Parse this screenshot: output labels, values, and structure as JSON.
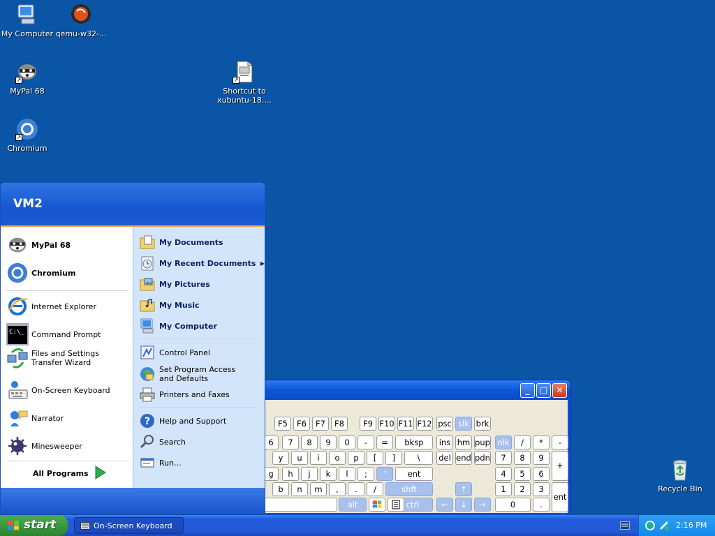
{
  "desktop": {
    "icons": [
      {
        "label": "My Computer"
      },
      {
        "label": "qemu-w32-..."
      },
      {
        "label": "MyPal 68"
      },
      {
        "label": "Shortcut to xubuntu-18...."
      },
      {
        "label": "Chromium"
      },
      {
        "label": "Recycle Bin"
      }
    ]
  },
  "start_menu": {
    "user": "VM2",
    "pinned": [
      {
        "label": "MyPal 68"
      },
      {
        "label": "Chromium"
      }
    ],
    "recent": [
      {
        "label": "Internet Explorer"
      },
      {
        "label": "Command Prompt"
      },
      {
        "label": "Files and Settings Transfer Wizard"
      },
      {
        "label": "On-Screen Keyboard"
      },
      {
        "label": "Narrator"
      },
      {
        "label": "Minesweeper"
      }
    ],
    "all_programs": "All Programs",
    "right": [
      {
        "label": "My Documents"
      },
      {
        "label": "My Recent Documents"
      },
      {
        "label": "My Pictures"
      },
      {
        "label": "My Music"
      },
      {
        "label": "My Computer"
      },
      {
        "label": "Control Panel"
      },
      {
        "label": "Set Program Access and Defaults"
      },
      {
        "label": "Printers and Faxes"
      },
      {
        "label": "Help and Support"
      },
      {
        "label": "Search"
      },
      {
        "label": "Run..."
      }
    ],
    "cmd_icon_text": "C:\\_"
  },
  "osk": {
    "row_f": [
      "F5",
      "F6",
      "F7",
      "F8",
      "F9",
      "F10",
      "F11",
      "F12",
      "psc",
      "slk",
      "brk"
    ],
    "row_1": [
      "6",
      "7",
      "8",
      "9",
      "0",
      "-",
      "=",
      "bksp",
      "ins",
      "hm",
      "pup",
      "nlk",
      "/",
      "*",
      "-"
    ],
    "row_2": [
      "y",
      "u",
      "i",
      "o",
      "p",
      "[",
      "]",
      "\\",
      "del",
      "end",
      "pdn",
      "7",
      "8",
      "9",
      "+"
    ],
    "row_3": [
      "g",
      "h",
      "j",
      "k",
      "l",
      ";",
      "'",
      "ent",
      "4",
      "5",
      "6"
    ],
    "row_4": [
      "b",
      "n",
      "m",
      ",",
      ".",
      "/",
      "shft",
      "↑",
      "1",
      "2",
      "3",
      "ent"
    ],
    "row_5": [
      "alt",
      "ctrl",
      "←",
      "↓",
      "→",
      "0",
      "."
    ],
    "winbtns": [
      "_",
      "□",
      "✕"
    ]
  },
  "taskbar": {
    "start_label": "start",
    "task": "On-Screen Keyboard",
    "clock": "2:16 PM"
  }
}
